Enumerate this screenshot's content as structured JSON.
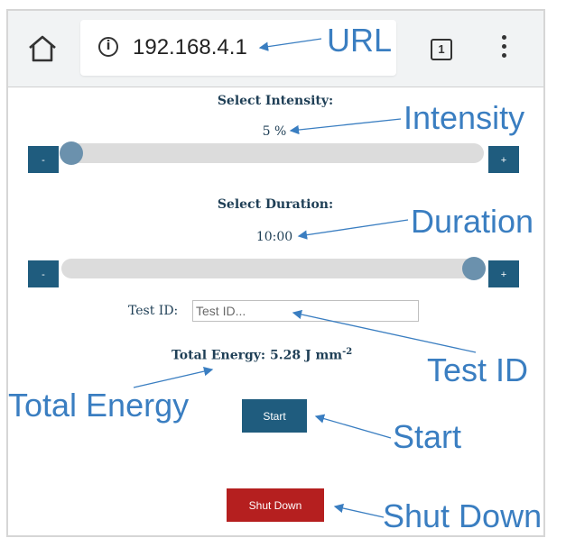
{
  "browser": {
    "url": "192.168.4.1",
    "tab_count": "1",
    "info_glyph": "i",
    "icons": [
      "home-icon",
      "info-icon",
      "tab-switcher-icon",
      "more-vert-icon"
    ]
  },
  "intensity": {
    "label": "Select Intensity:",
    "value_text": "5 %",
    "slider_fraction": 0.0,
    "minus_label": "-",
    "plus_label": "+"
  },
  "duration": {
    "label": "Select Duration:",
    "value_text": "10:00",
    "slider_fraction": 1.0,
    "minus_label": "-",
    "plus_label": "+"
  },
  "test_id": {
    "label": "Test ID:",
    "value": "",
    "placeholder": "Test ID..."
  },
  "energy": {
    "text": "Total Energy: 5.28 J mm",
    "superscript": "-2"
  },
  "buttons": {
    "start": "Start",
    "shutdown": "Shut Down"
  },
  "callouts": {
    "url": "URL",
    "intensity": "Intensity",
    "duration": "Duration",
    "test_id": "Test ID",
    "total_energy": "Total Energy",
    "start": "Start",
    "shutdown": "Shut Down"
  },
  "colors": {
    "accent": "#1f5c7e",
    "danger": "#b51f1f",
    "callout": "#3a7ec1",
    "slider_thumb": "#6b91ad",
    "slider_track": "#dcdcdc"
  }
}
